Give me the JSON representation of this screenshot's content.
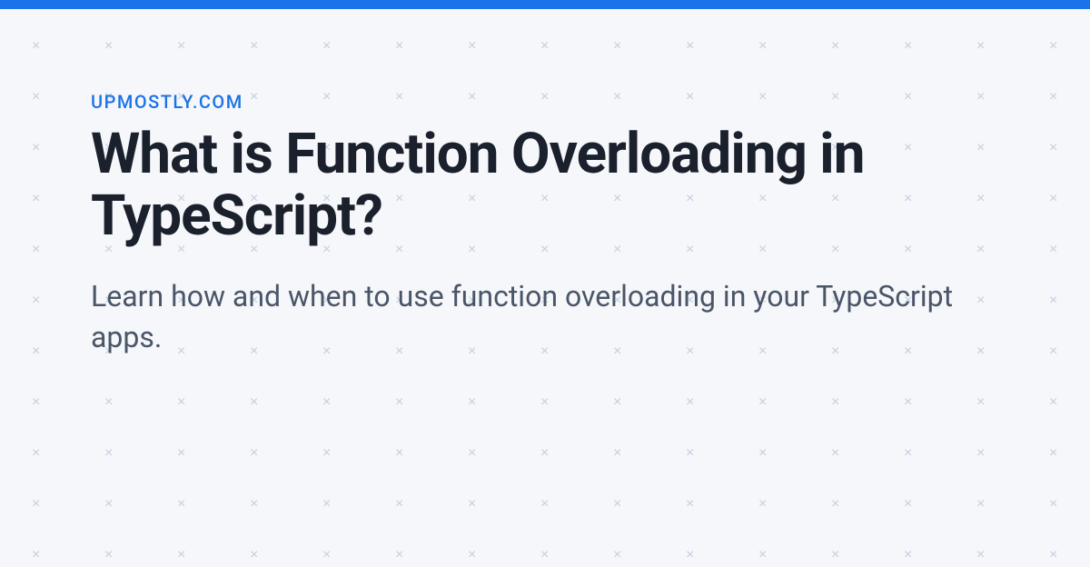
{
  "header": {
    "site_label": "UPMOSTLY.COM",
    "accent_color": "#1a73e8"
  },
  "main": {
    "title": "What is Function Overloading in TypeScript?",
    "subtitle": "Learn how and when to use function overloading in your TypeScript apps."
  },
  "pattern": {
    "glyph": "×",
    "color": "#c3cfe0"
  }
}
